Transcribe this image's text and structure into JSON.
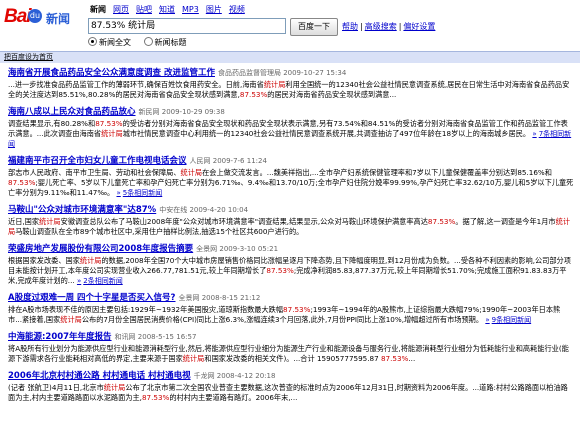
{
  "brand": {
    "logo_text": "Bai",
    "logo_paw": "du",
    "logo_news": "新闻"
  },
  "tabs": [
    {
      "label": "新闻",
      "active": true
    },
    {
      "label": "网页"
    },
    {
      "label": "贴吧"
    },
    {
      "label": "知道"
    },
    {
      "label": "MP3"
    },
    {
      "label": "图片"
    },
    {
      "label": "视频"
    }
  ],
  "search": {
    "query": "87.53% 统计局",
    "button": "百度一下",
    "links": [
      "帮助",
      "高级搜索",
      "偏好设置"
    ],
    "sep": "|"
  },
  "radios": [
    {
      "label": "新闻全文",
      "checked": true
    },
    {
      "label": "新闻标题",
      "checked": false
    }
  ],
  "settings_bar": {
    "label": "把百度设为首页"
  },
  "results": [
    {
      "title": "海南省开展食品药品安全公众满意度调查 改进监管工作",
      "source": "食品药品监督管理局 2009-10-27 15:34",
      "snippet": "...进一步找准食品药品监管工作的薄弱环节,确保百姓饮食用药安全。日前,海南省统计局利用全国统一的12340社会公益社情民意调查系统,居民在日常生活中对海南省食品药品安全的关注度达到85.51%,80.28%的居民对海南省食品安全现状感到满意,87.53%的居民对海南省药品安全现状感到满意...",
      "more": ""
    },
    {
      "title": "海南八成以上民众对食品药品放心",
      "source": "新民网 2009-10-29 09:38",
      "snippet": "调查结果显示,有80.28%和87.53%的受访者分别对海南省食品安全现状和药品安全现状表示满意,另有73.54%和84.51%的受访者分别对海南省食品监管工作和药品监管工作表示满意。...此次调查由海南省统计局城市社情民意调查中心利用统一的12340社会公益社情民意调查系统开展,共调查抽访了497位年龄在18岁以上的海南城乡居民。",
      "more": "7条相同新闻"
    },
    {
      "title": "福建南平市召开全市妇女儿童工作电视电话会议",
      "source": "人民网 2009-7-6 11:24",
      "snippet": "部志市人民政府、南平市卫生局、劳动和社会保障局、统计局在会上做交流发言。...魏美祥指出,...全市孕产妇系统保健管理率和7岁以下儿童保健覆盖率分别达到85.16%和87.53%;婴儿死亡率、5岁以下儿童死亡率和孕产妇死亡率分别为6.71‰、9.4‰和13.70/10万;全市孕产妇住院分娩率99.99%,孕产妇死亡率32.62/10万,婴儿和5岁以下儿童死亡率分别为9.11‰和11.47‰。",
      "more": "5条相同新闻"
    },
    {
      "title": "马鞍山\"公众对城市环境满意率\"达87%",
      "source": "中安在线 2009-4-20 10:04",
      "snippet": "近日,国家统计局安徽调查总队公布了马鞍山2008年度\"公众对城市环境满意率\"调查结果,结果显示,公众对马鞍山环境保护满意率高达87.53%。据了解,这一调查是今年1月市统计局马鞍山调查队在全市89个城市社区中,采用住户抽样比例法,抽选15个社区共600户进行的。",
      "more": ""
    },
    {
      "title": "荣盛房地产发展股份有限公司2008年度报告摘要",
      "source": "全景网 2009-3-10 05:21",
      "snippet": "根据国家发改委、国家统计局的数据,2008年全国70个大中城市房屋销售价格同比涨幅呈逐月下降态势,且下降幅度明显,到12月份成为负数。...受各种不利因素的影响,公司部分项目未能按计划开工,本年度公司实现营业收入266.77,781.51元,较上年同期增长了87.53%;完成净利润85.83,877.37万元,较上年同期增长51.70%;完成施工面积91.83.83万平米,完成年度计划的...",
      "more": "2条相同新闻"
    },
    {
      "title": "A股度过艰难一周 四个十字星是否买入信号?",
      "source": "全景网 2008-8-15 21:12",
      "snippet": "排在A股市场表现不佳的原因主要包括:1929年~1932年美国股灾,道琼斯指数最大跌幅87.53%;1993年~1994年的A股熊市,上证综指最大跌幅79%;1990年~2003年日本熊市...紧接着,国家统计局公布的7月份全国居民消费价格(CPI)同比上涨6.3%,涨幅连续3个月回落,此外,7月份PPI同比上涨10%,增幅超过所有市场预期。",
      "more": "9条相同新闻"
    },
    {
      "title": "中海能源:2007年年度报告",
      "source": "和讯网 2008-5-15 16:57",
      "snippet": "将A股所有行业划分为能源供应型行业和能源消耗型行业,然后,将能源供应型行业细分为能源生产行业和能源设备与服务行业,将能源消耗型行业细分为低耗能行业和高耗能行业(能源下游需求各行业能耗相对高低的界定,主要来源于国家统计局和国家发改委的相关文件)。...合计 15905777595.87 87.53%...",
      "more": ""
    },
    {
      "title": "2006年北京村村通公路 村村通电话 村村通电视",
      "source": "千龙网 2008-4-12 20:18",
      "snippet": "(记者 张航卫)4月11日,北京市统计局公布了北京市第二次全国农业普查主要数据,这次普查的标准时点为2006年12月31日,时期资料为2006年度。...道路:村村公路路面以柏油路面为主,村内主要道路路面以水泥路面为主,87.53%的村村内主要道路有路灯。2006年末,...",
      "more": ""
    }
  ]
}
